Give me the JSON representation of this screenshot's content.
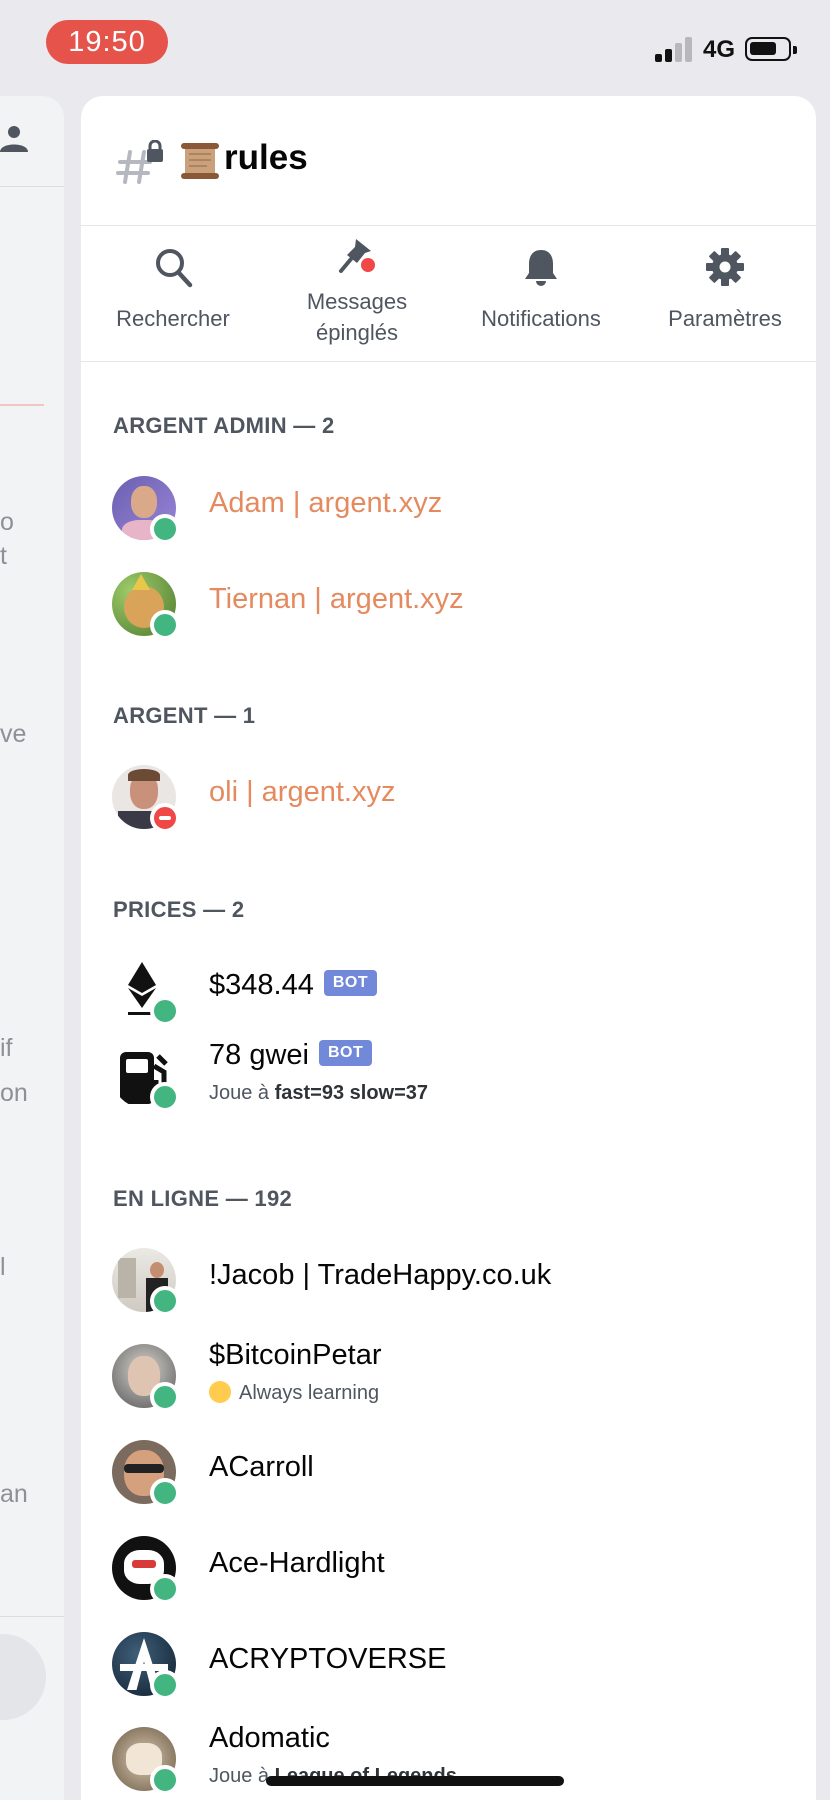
{
  "status_bar": {
    "time": "19:50",
    "network": "4G"
  },
  "left_panel": {
    "fragments": [
      {
        "text": "o"
      },
      {
        "text": "t"
      },
      {
        "text": "ve"
      },
      {
        "text": "if"
      },
      {
        "text": "on"
      },
      {
        "text": "l"
      },
      {
        "text": "an"
      }
    ]
  },
  "channel": {
    "name": "rules"
  },
  "toolbar": {
    "search_label": "Rechercher",
    "pinned_label_line1": "Messages",
    "pinned_label_line2": "épinglés",
    "notifications_label": "Notifications",
    "settings_label": "Paramètres"
  },
  "sections": [
    {
      "header": "ARGENT ADMIN — 2"
    },
    {
      "header": "ARGENT — 1"
    },
    {
      "header": "PRICES — 2"
    },
    {
      "header": "EN LIGNE — 192"
    }
  ],
  "members": [
    {
      "name": "Adam | argent.xyz",
      "status": "online"
    },
    {
      "name": "Tiernan | argent.xyz",
      "status": "online"
    },
    {
      "name": "oli | argent.xyz",
      "status": "dnd"
    },
    {
      "name": "$348.44",
      "tag": "BOT",
      "status": "online"
    },
    {
      "name": "78 gwei",
      "tag": "BOT",
      "status": "online",
      "activity_prefix": "Joue à ",
      "activity_value": "fast=93 slow=37"
    },
    {
      "name": "!Jacob | TradeHappy.co.uk",
      "status": "online"
    },
    {
      "name": "$BitcoinPetar",
      "status": "online",
      "custom_status": "Always learning"
    },
    {
      "name": "ACarroll",
      "status": "online"
    },
    {
      "name": "Ace-Hardlight",
      "status": "online"
    },
    {
      "name": "ACRYPTOVERSE",
      "status": "online"
    },
    {
      "name": "Adomatic",
      "status": "online",
      "activity_prefix": "Joue à ",
      "activity_value": "League of Legends"
    }
  ],
  "colors": {
    "admin_role": "#e58a5e",
    "online": "#43b581",
    "dnd": "#f04747",
    "bot_tag": "#7289da"
  }
}
